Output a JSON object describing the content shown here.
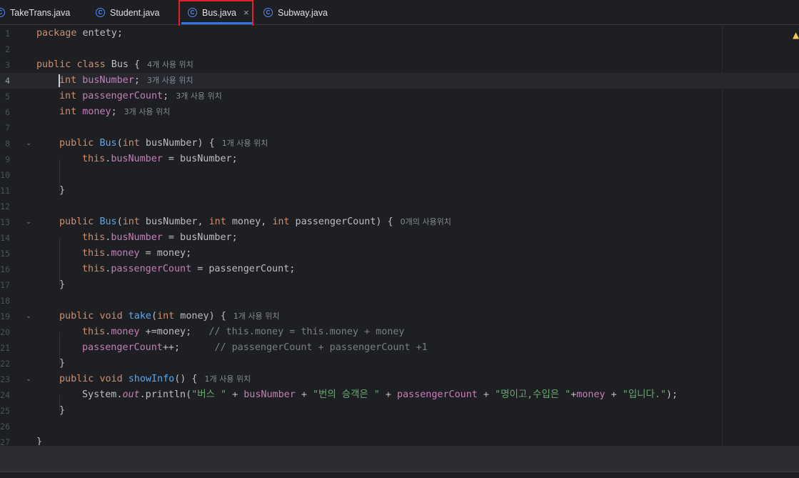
{
  "tabs": [
    {
      "label": "TakeTrans.java",
      "icon": "java-class-icon",
      "active": false
    },
    {
      "label": "Student.java",
      "icon": "java-class-icon",
      "active": false
    },
    {
      "label": "Bus.java",
      "icon": "java-class-icon",
      "active": true,
      "close": "×"
    },
    {
      "label": "Subway.java",
      "icon": "java-class-icon",
      "active": false
    }
  ],
  "icon_letter": "C",
  "colors": {
    "accent": "#3574f0",
    "highlight_box": "#e8202a",
    "background": "#1e1f22"
  },
  "editor": {
    "current_line": 4,
    "lines": [
      {
        "n": "1"
      },
      {
        "n": "2"
      },
      {
        "n": "3"
      },
      {
        "n": "4"
      },
      {
        "n": "5"
      },
      {
        "n": "6"
      },
      {
        "n": "7"
      },
      {
        "n": "8"
      },
      {
        "n": "9"
      },
      {
        "n": "10"
      },
      {
        "n": "11"
      },
      {
        "n": "12"
      },
      {
        "n": "13"
      },
      {
        "n": "14"
      },
      {
        "n": "15"
      },
      {
        "n": "16"
      },
      {
        "n": "17"
      },
      {
        "n": "18"
      },
      {
        "n": "19"
      },
      {
        "n": "20"
      },
      {
        "n": "21"
      },
      {
        "n": "22"
      },
      {
        "n": "23"
      },
      {
        "n": "24"
      },
      {
        "n": "25"
      },
      {
        "n": "26"
      },
      {
        "n": "27"
      }
    ],
    "code": {
      "l1": {
        "kw": "package",
        "rest": " entety;"
      },
      "l3": {
        "kw1": "public",
        "kw2": "class",
        "rest": " Bus {",
        "hint": "4개 사용 위치"
      },
      "l4": {
        "kw": "int",
        "field": "busNumber",
        "rest": ";",
        "hint": "3개 사용 위치"
      },
      "l5": {
        "kw": "int",
        "field": "passengerCount",
        "rest": ";",
        "hint": "3개 사용 위치"
      },
      "l6": {
        "kw": "int",
        "field": "money",
        "rest": ";",
        "hint": "3개 사용 위치"
      },
      "l8": {
        "kw": "public",
        "fn": "Bus",
        "open": "(",
        "kw2": "int",
        "rest": " busNumber) {",
        "hint": "1개 사용 위치"
      },
      "l9": {
        "kw": "this",
        "field": "busNumber",
        "rest": " = busNumber;"
      },
      "l11": {
        "rest": "}"
      },
      "l13": {
        "kw": "public",
        "fn": "Bus",
        "open": "(",
        "kw2": "int",
        "p1": " busNumber, ",
        "kw3": "int",
        "p2": " money, ",
        "kw4": "int",
        "p3": " passengerCount) {",
        "hint": "0개의 사용위치"
      },
      "l14": {
        "kw": "this",
        "field": "busNumber",
        "rest": " = busNumber;"
      },
      "l15": {
        "kw": "this",
        "field": "money",
        "rest": " = money;"
      },
      "l16": {
        "kw": "this",
        "field": "passengerCount",
        "rest": " = passengerCount;"
      },
      "l17": {
        "rest": "}"
      },
      "l19": {
        "kw1": "public",
        "kw2": "void",
        "fn": "take",
        "open": "(",
        "kw3": "int",
        "rest": " money) {",
        "hint": "1개 사용 위치"
      },
      "l20": {
        "kw": "this",
        "field": "money",
        "rest": " +=money;",
        "comment": "// this.money = this.money + money"
      },
      "l21": {
        "field": "passengerCount",
        "rest": "++;",
        "comment": "// passengerCount + passengerCount +1"
      },
      "l22": {
        "rest": "}"
      },
      "l23": {
        "kw1": "public",
        "kw2": "void",
        "fn": "showInfo",
        "rest": "() {",
        "hint": "1개 사용 위치"
      },
      "l24": {
        "cls": "System.",
        "static": "out",
        "call": ".println(",
        "s1": "\"버스 \"",
        "op1": " + ",
        "f1": "busNumber",
        "op2": " + ",
        "s2": "\"번의 승객은 \"",
        "op3": " + ",
        "f2": "passengerCount",
        "op4": " + ",
        "s3": "\"명이고,수입은 \"",
        "op5": "+",
        "f3": "money",
        "op6": " + ",
        "s4": "\"입니다.\"",
        "end": ");"
      },
      "l25": {
        "rest": "}"
      },
      "l27": {
        "rest": "}"
      }
    }
  }
}
